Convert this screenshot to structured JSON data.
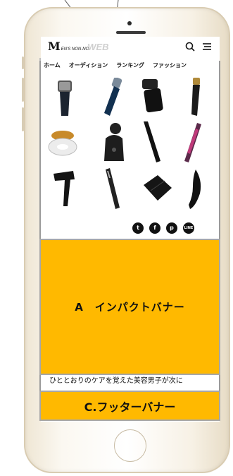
{
  "header": {
    "logo_main": "M",
    "logo_small": "EN'S NON-NO",
    "logo_web": "WEB"
  },
  "nav": {
    "tabs": [
      "ホーム",
      "オーディション",
      "ランキング",
      "ファッション"
    ]
  },
  "share": {
    "twitter": "t",
    "facebook": "f",
    "pinterest": "p",
    "line": "LINE"
  },
  "banner_a": {
    "label": "A　インパクトバナー"
  },
  "caption": {
    "text": "ひととおりのケアを覚えた美容男子が次に"
  },
  "banner_c": {
    "label": "C.フッターバナー"
  },
  "colors": {
    "banner": "#ffb900",
    "frame": "#a7a7a7"
  }
}
